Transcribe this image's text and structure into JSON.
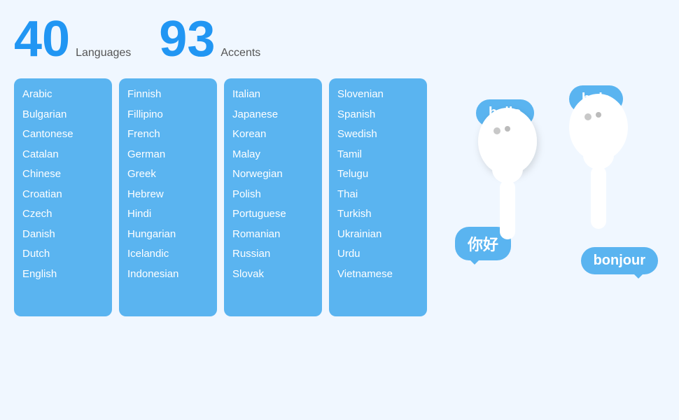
{
  "header": {
    "stat1": {
      "number": "40",
      "label": "Languages"
    },
    "stat2": {
      "number": "93",
      "label": "Accents"
    }
  },
  "columns": [
    {
      "id": "col1",
      "items": [
        "Arabic",
        "Bulgarian",
        "Cantonese",
        "Catalan",
        "Chinese",
        "Croatian",
        "Czech",
        "Danish",
        "Dutch",
        "English"
      ]
    },
    {
      "id": "col2",
      "items": [
        "Finnish",
        "Fillipino",
        "French",
        "German",
        "Greek",
        "Hebrew",
        "Hindi",
        "Hungarian",
        "Icelandic",
        "Indonesian"
      ]
    },
    {
      "id": "col3",
      "items": [
        "Italian",
        "Japanese",
        "Korean",
        "Malay",
        "Norwegian",
        "Polish",
        "Portuguese",
        "Romanian",
        "Russian",
        "Slovak"
      ]
    },
    {
      "id": "col4",
      "items": [
        "Slovenian",
        "Spanish",
        "Swedish",
        "Tamil",
        "Telugu",
        "Thai",
        "Turkish",
        "Ukrainian",
        "Urdu",
        "Vietnamese"
      ]
    }
  ],
  "bubbles": {
    "hello": "hello",
    "hola": "hola",
    "nihao": "你好",
    "bonjour": "bonjour"
  }
}
